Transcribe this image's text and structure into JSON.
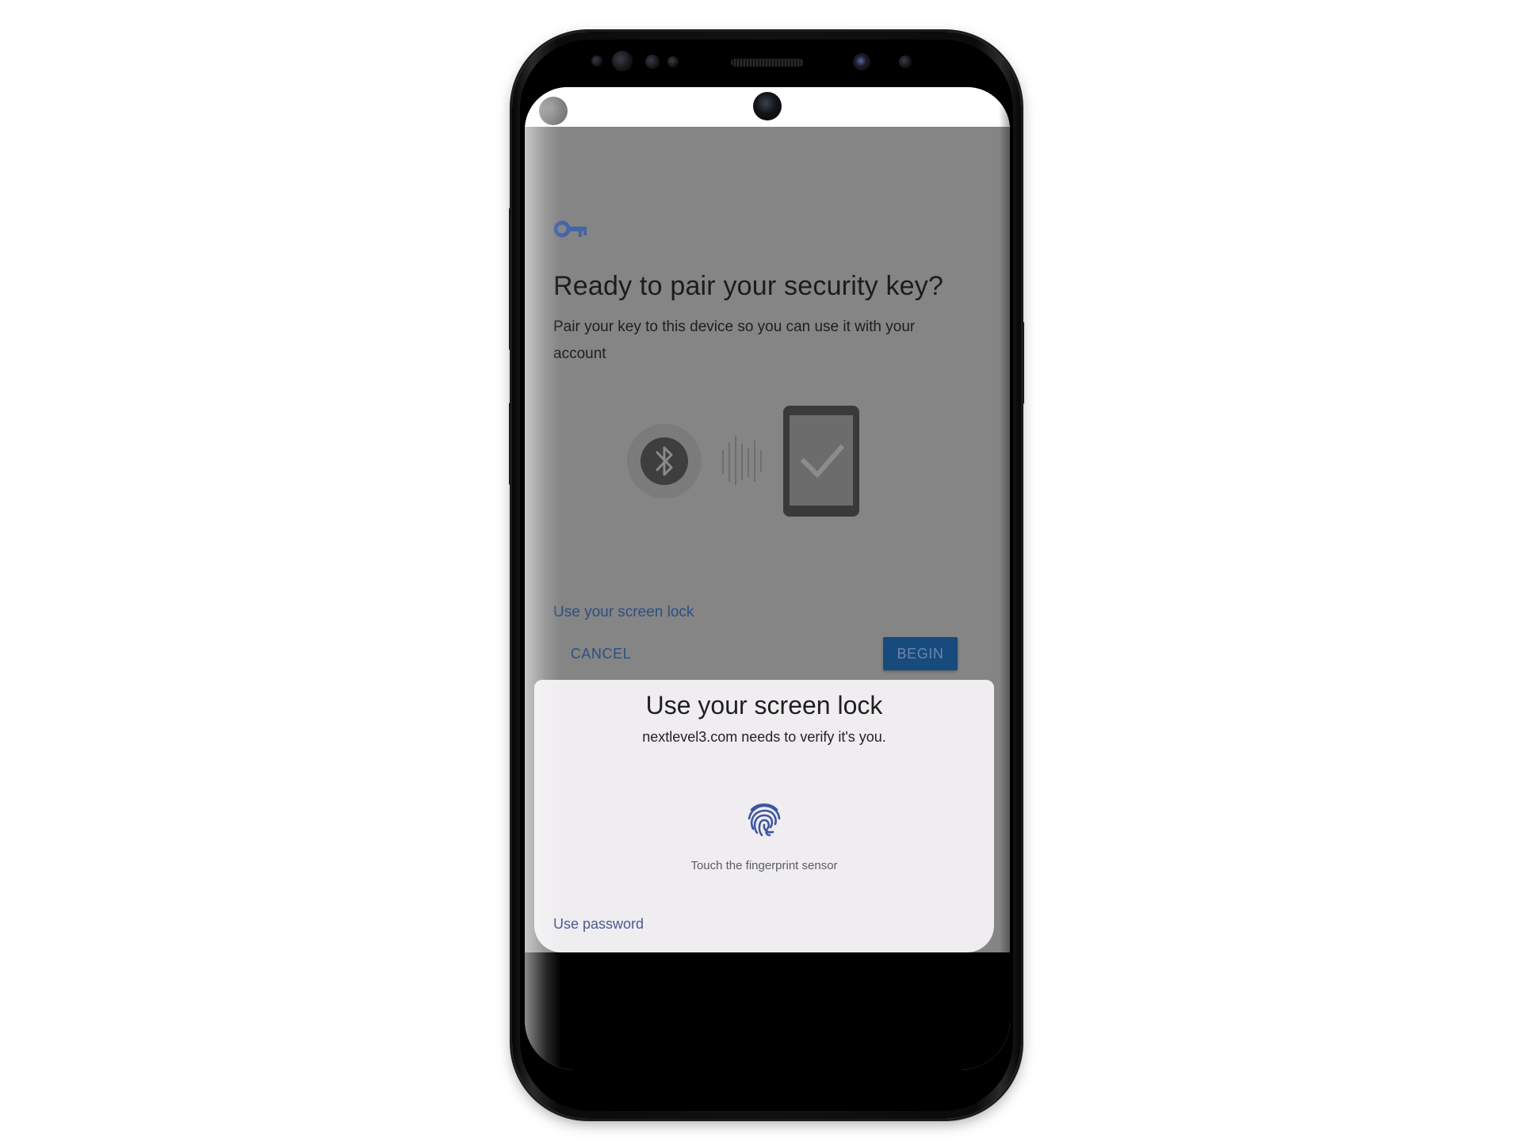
{
  "app": {
    "title": "Ready to pair your security key?",
    "subtitle": "Pair your key to this device so you can use it with your account",
    "screen_lock_link": "Use your screen lock",
    "cancel_label": "CANCEL",
    "begin_label": "BEGIN"
  },
  "sheet": {
    "title": "Use your screen lock",
    "subtitle": "nextlevel3.com needs to verify it's you.",
    "hint": "Touch the fingerprint sensor",
    "use_password_label": "Use password"
  },
  "icons": {
    "key": "key-icon",
    "bluetooth": "bluetooth-icon",
    "signal_waves": "signal-waves-icon",
    "phone_check": "phone-check-icon",
    "fingerprint": "fingerprint-icon"
  },
  "colors": {
    "scrim": "#858585",
    "link_blue": "#2d4e82",
    "begin_button_bg": "#174a7d",
    "sheet_bg": "#efedf0",
    "fingerprint": "#3e55a3",
    "key_icon": "#4466a6"
  }
}
